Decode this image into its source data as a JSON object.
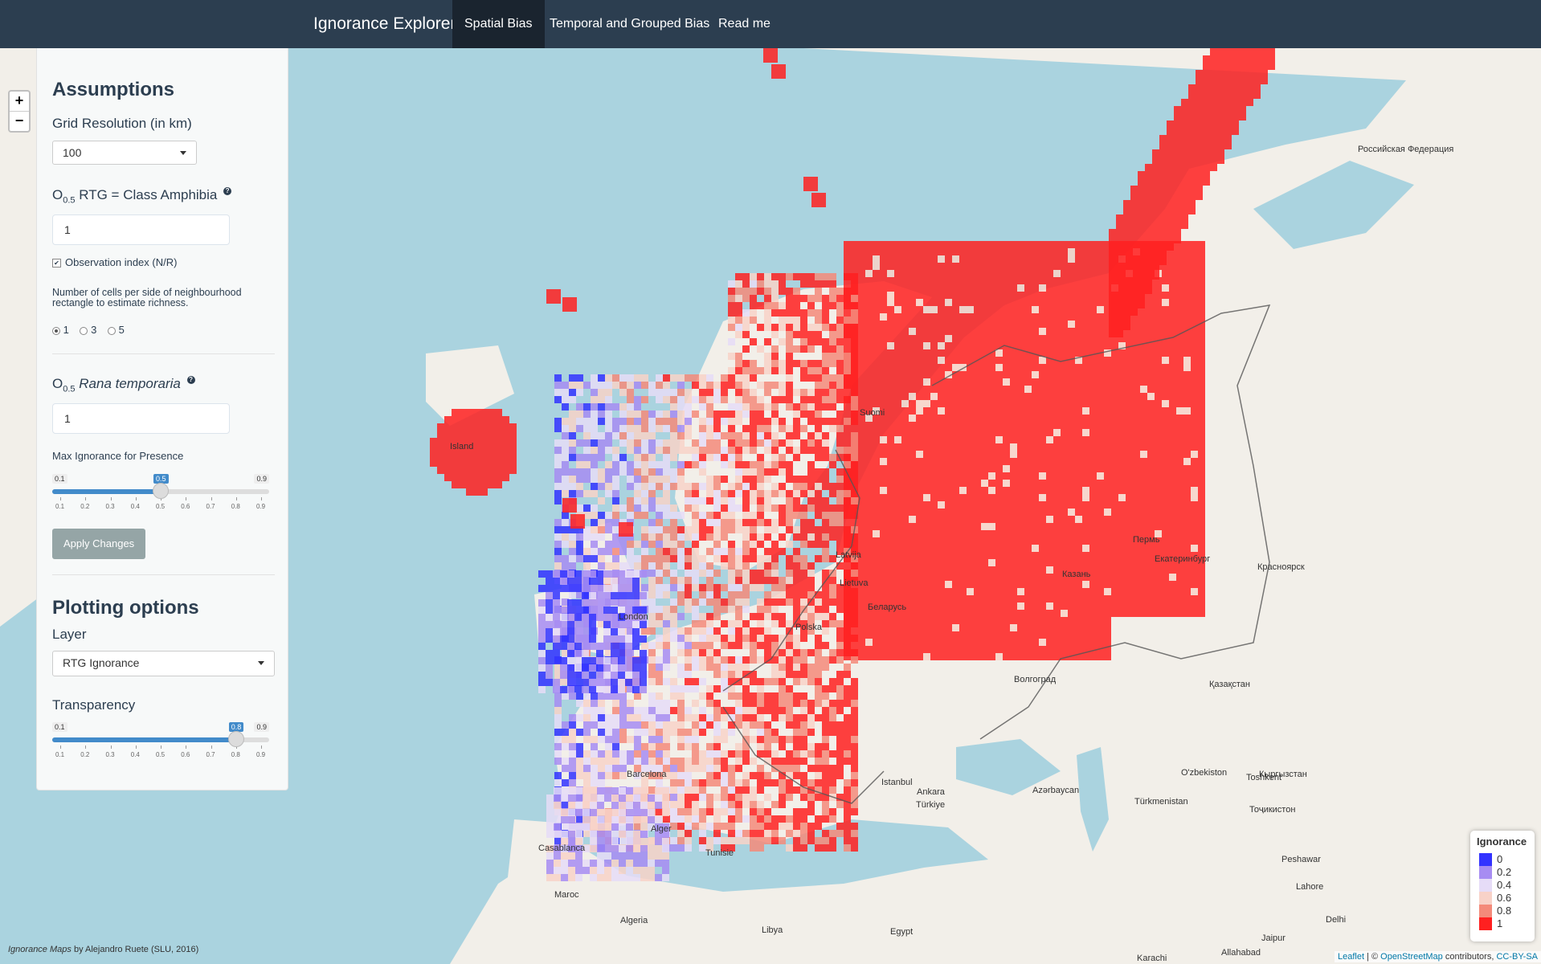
{
  "navbar": {
    "brand": "Ignorance Explorer",
    "tabs": [
      {
        "label": "Spatial Bias",
        "active": true
      },
      {
        "label": "Temporal and Grouped Bias",
        "active": false
      },
      {
        "label": "Read me",
        "active": false
      }
    ]
  },
  "map": {
    "zoom_in": "+",
    "zoom_out": "−",
    "labels": [
      "Российская Федерация",
      "Island",
      "Suomi",
      "Latvija",
      "Lietuva",
      "Беларусь",
      "Polska",
      "London",
      "Barcelona",
      "Alger",
      "Tunisie",
      "Casablanca",
      "Maroc",
      "Algeria",
      "Libya",
      "Egypt",
      "Istanbul",
      "Ankara",
      "Türkiye",
      "Azərbaycan",
      "Türkmenistan",
      "Toshkent",
      "Қазақстан",
      "Казань",
      "Пермь",
      "Екатеринбург",
      "Красноярск",
      "Волгоград",
      "O'zbekiston",
      "Peshawar",
      "Lahore",
      "Delhi",
      "Jaipur",
      "Karachi",
      "Allahabad",
      "Тоҷикистон",
      "Кыргызстан"
    ]
  },
  "panel": {
    "assumptions_title": "Assumptions",
    "grid_res_label": "Grid Resolution (in km)",
    "grid_res_value": "100",
    "o_rtg_label_pre": "O",
    "o_rtg_sub": "0.5",
    "o_rtg_label_post": " RTG = Class Amphibia",
    "o_rtg_value": "1",
    "obs_index_label": "Observation index (N/R)",
    "obs_index_checked": true,
    "neigh_label": "Number of cells per side of neighbourhood rectangle to estimate richness.",
    "neigh_options": [
      "1",
      "3",
      "5"
    ],
    "neigh_selected": "1",
    "o_species_label_pre": "O",
    "o_species_sub": "0.5",
    "o_species_name": "Rana temporaria",
    "o_species_value": "1",
    "max_ign_label": "Max Ignorance for Presence",
    "max_ign": {
      "min": "0.1",
      "max": "0.9",
      "value": 0.5,
      "value_label": "0.5"
    },
    "apply_button": "Apply Changes",
    "plotting_title": "Plotting options",
    "layer_label": "Layer",
    "layer_value": "RTG Ignorance",
    "transparency_label": "Transparency",
    "transparency": {
      "min": "0.1",
      "max": "0.9",
      "value": 0.8,
      "value_label": "0.8"
    },
    "slider_ticks": [
      "0.1",
      "0.2",
      "0.3",
      "0.4",
      "0.5",
      "0.6",
      "0.7",
      "0.8",
      "0.9"
    ],
    "help_icon": "question-circle-icon"
  },
  "legend": {
    "title": "Ignorance",
    "levels": [
      "0",
      "0.2",
      "0.4",
      "0.6",
      "0.8",
      "1"
    ],
    "colors": [
      "#3333ff",
      "#a78cf2",
      "#e6dcf7",
      "#f8d2c8",
      "#f48a7a",
      "#ff2020"
    ]
  },
  "credits": {
    "left_italic": "Ignorance Maps",
    "left_rest": " by Alejandro Ruete (SLU, 2016)",
    "leaflet": "Leaflet",
    "osm_pre": " | © ",
    "osm": "OpenStreetMap",
    "osm_post": " contributors, ",
    "license": "CC-BY-SA"
  }
}
